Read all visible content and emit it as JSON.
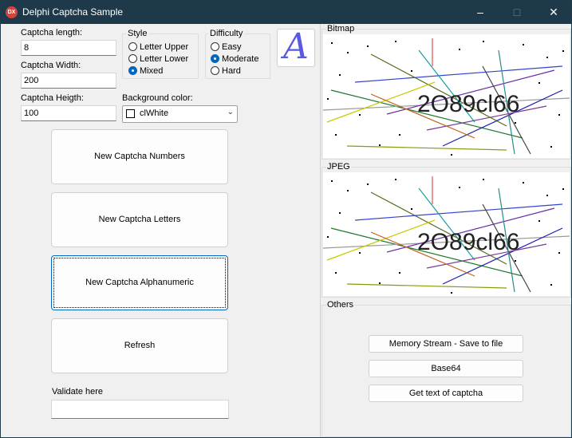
{
  "window": {
    "title": "Delphi Captcha Sample",
    "icon_text": "DX",
    "minimize_icon": "minimize-icon",
    "maximize_icon": "maximize-icon",
    "close_icon": "close-icon"
  },
  "settings": {
    "length_label": "Captcha length:",
    "length_value": "8",
    "width_label": "Captcha Width:",
    "width_value": "200",
    "height_label": "Captcha Heigth:",
    "height_value": "100",
    "background_label": "Background color:",
    "background_value": "clWhite",
    "background_swatch": "#ffffff"
  },
  "style_group": {
    "title": "Style",
    "options": [
      "Letter Upper",
      "Letter Lower",
      "Mixed"
    ],
    "selected": "Mixed"
  },
  "difficulty_group": {
    "title": "Difficulty",
    "options": [
      "Easy",
      "Moderate",
      "Hard"
    ],
    "selected": "Moderate"
  },
  "font_preview": {
    "glyph": "A",
    "color": "#5a5ae0"
  },
  "buttons": {
    "numbers": "New Captcha Numbers",
    "letters": "New Captcha Letters",
    "alphanumeric": "New Captcha Alphanumeric",
    "refresh": "Refresh"
  },
  "validate": {
    "label": "Validate here",
    "value": ""
  },
  "panels": {
    "bitmap_title": "Bitmap",
    "jpeg_title": "JPEG",
    "others_title": "Others",
    "captcha_text": "2O89cl66"
  },
  "others_buttons": {
    "memory_stream": "Memory Stream - Save to file",
    "base64": "Base64",
    "get_text": "Get text of captcha"
  }
}
